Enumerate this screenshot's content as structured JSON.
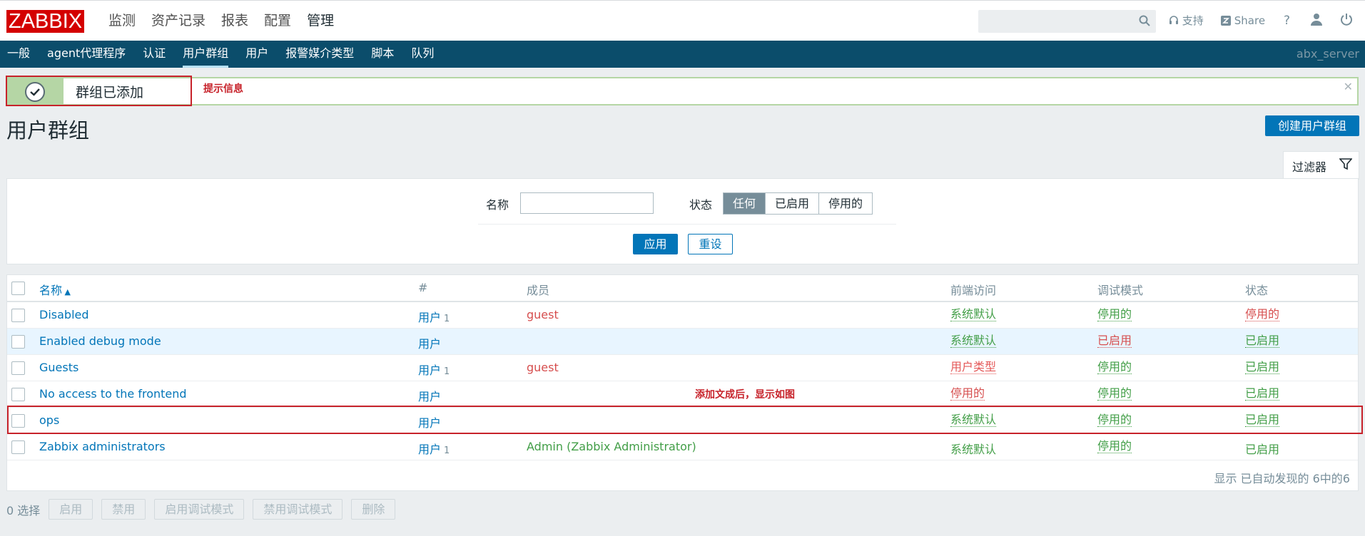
{
  "header": {
    "logo": "ZABBIX",
    "menu": [
      "监测",
      "资产记录",
      "报表",
      "配置",
      "管理"
    ],
    "active_menu": "管理",
    "support": "支持",
    "share": "Share",
    "help": "?"
  },
  "subnav": {
    "items": [
      "一般",
      "agent代理程序",
      "认证",
      "用户群组",
      "用户",
      "报警媒介类型",
      "脚本",
      "队列"
    ],
    "server": "abx_server"
  },
  "message": {
    "text": "群组已添加",
    "annotation": "提示信息"
  },
  "page": {
    "title": "用户群组",
    "create_button": "创建用户群组"
  },
  "filter": {
    "tab_label": "过滤器",
    "name_label": "名称",
    "name_value": "",
    "status_label": "状态",
    "status_options": [
      "任何",
      "已启用",
      "停用的"
    ],
    "status_selected": "任何",
    "apply": "应用",
    "reset": "重设"
  },
  "table": {
    "headers": {
      "name": "名称",
      "count": "#",
      "members": "成员",
      "frontend": "前端访问",
      "debug": "调试模式",
      "status": "状态"
    },
    "rows": [
      {
        "name": "Disabled",
        "users": "用户",
        "count": "1",
        "members": "guest",
        "frontend": "系统默认",
        "debug": "停用的",
        "status": "停用的"
      },
      {
        "name": "Enabled debug mode",
        "users": "用户",
        "count": "",
        "members": "",
        "frontend": "系统默认",
        "debug": "已启用",
        "status": "已启用"
      },
      {
        "name": "Guests",
        "users": "用户",
        "count": "1",
        "members": "guest",
        "frontend": "用户类型",
        "debug": "停用的",
        "status": "已启用"
      },
      {
        "name": "No access to the frontend",
        "users": "用户",
        "count": "",
        "members": "",
        "frontend": "停用的",
        "debug": "停用的",
        "status": "已启用"
      },
      {
        "name": "ops",
        "users": "用户",
        "count": "",
        "members": "",
        "frontend": "系统默认",
        "debug": "停用的",
        "status": "已启用"
      },
      {
        "name": "Zabbix administrators",
        "users": "用户",
        "count": "1",
        "members": "Admin (Zabbix Administrator)",
        "frontend": "系统默认",
        "debug": "停用的",
        "status": "已启用"
      }
    ],
    "footer": "显示 已自动发现的 6中的6",
    "annotation": "添加文成后，显示如图"
  },
  "actions": {
    "selected": "0 选择",
    "buttons": [
      "启用",
      "禁用",
      "启用调试模式",
      "禁用调试模式",
      "删除"
    ]
  }
}
